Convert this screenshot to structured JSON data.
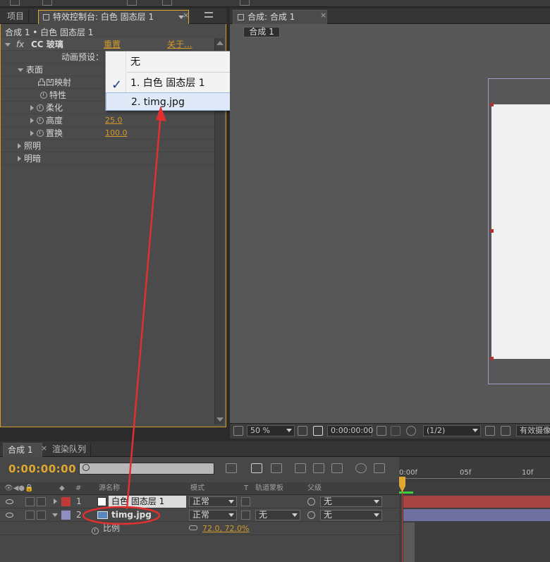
{
  "left_tabs": {
    "project": "项目",
    "effects": "特效控制台: 白色 固态层 1"
  },
  "effects_panel": {
    "breadcrumb": "合成 1 • 白色 固态层 1",
    "effect_fx": "fx",
    "effect_name": "CC 玻璃",
    "reset": "重置",
    "about": "关于...",
    "preset_label": "动画预设：",
    "surface_group": "表面",
    "bump_map": "凸凹映射",
    "property": "特性",
    "softness": "柔化",
    "height": "高度",
    "height_value": "25.0",
    "displacement": "置换",
    "displacement_value": "100.0",
    "lighting_group": "照明",
    "shading_group": "明暗"
  },
  "dropdown": {
    "items": [
      "无",
      "1. 白色 固态层 1",
      "2. timg.jpg"
    ],
    "checked_index": 1,
    "hover_index": 2
  },
  "right_tabs": {
    "comp": "合成: 合成 1"
  },
  "comp_viewer": {
    "crumb": "合成 1",
    "zoom": "50 %",
    "timecode": "0:00:00:00",
    "resolution": "(1/2)",
    "camera": "有效摄像"
  },
  "timeline": {
    "tab_comp": "合成 1",
    "tab_queue": "渲染队列",
    "timecode": "0:00:00:00",
    "col_hash": "#",
    "col_source": "源名称",
    "col_mode": "模式",
    "col_t": "T",
    "col_trkmat": "轨道蒙板",
    "col_parent": "父级",
    "ruler_labels": [
      "0:00f",
      "05f",
      "10f"
    ],
    "layers": [
      {
        "num": "1",
        "name": "白色 固态层 1",
        "mode": "正常",
        "parent": "无",
        "color": "#c03a3a"
      },
      {
        "num": "2",
        "name": "timg.jpg",
        "mode": "正常",
        "trkmat": "无",
        "parent": "无",
        "color": "#8e8ec0"
      }
    ],
    "scale_label": "比例",
    "scale_value": "72.0, 72.0%"
  }
}
